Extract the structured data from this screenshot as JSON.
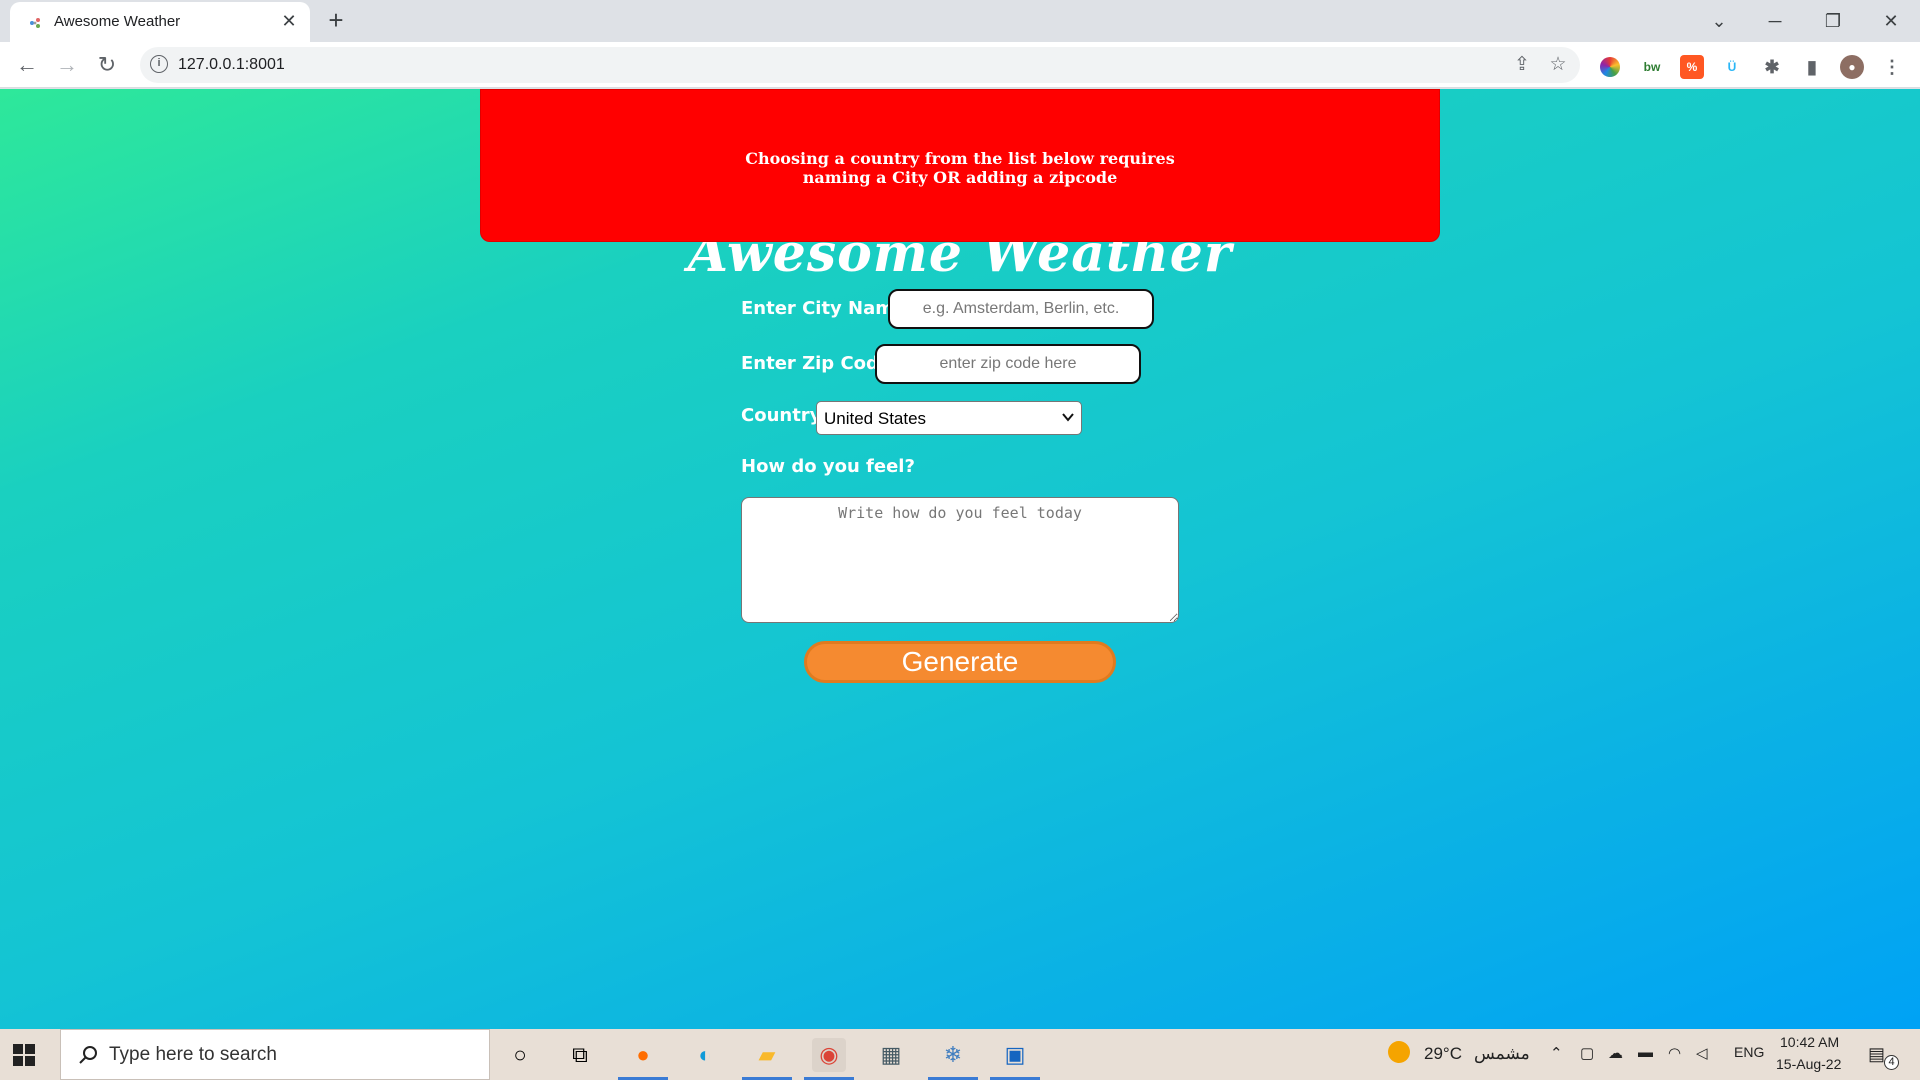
{
  "browser": {
    "tab_title": "Awesome Weather",
    "tab_close": "✕",
    "new_tab": "+",
    "url": "127.0.0.1:8001"
  },
  "page": {
    "alert_line1": "Choosing a country from the list below requires",
    "alert_line2": "naming a City OR adding a zipcode",
    "title": "Awesome Weather",
    "city_label": "Enter City Name",
    "city_placeholder": "e.g. Amsterdam, Berlin, etc.",
    "zip_label": "Enter Zip Code",
    "zip_placeholder": "enter zip code here",
    "country_label": "Country",
    "country_value": "United States",
    "feel_label": "How do you feel?",
    "feel_placeholder": "Write how do you feel today",
    "generate_label": "Generate"
  },
  "taskbar": {
    "search_placeholder": "Type here to search",
    "weather_temp": "29°C",
    "weather_text": "مشمس",
    "lang": "ENG",
    "time": "10:42 AM",
    "date": "15-Aug-22",
    "notification_count": "4"
  },
  "colors": {
    "alert": "#ff0000",
    "generate_button": "#f58a30",
    "gradient_start": "#2ee89a",
    "gradient_end": "#00a2f5"
  }
}
